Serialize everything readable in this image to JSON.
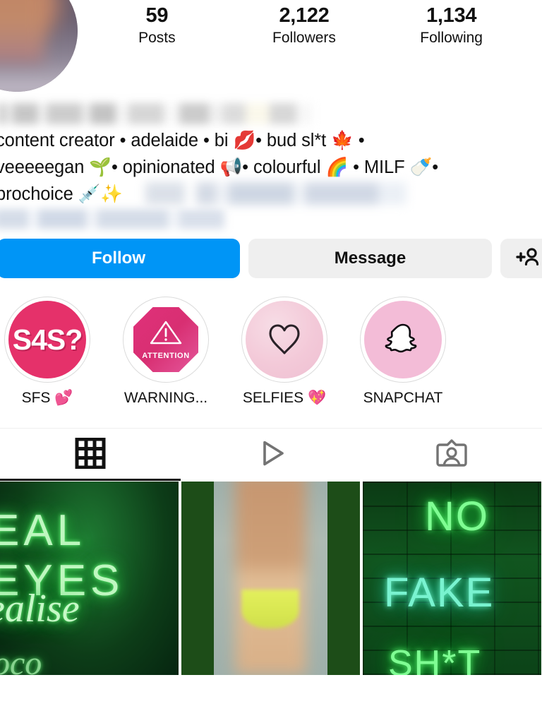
{
  "app": "instagram-profile",
  "profile": {
    "avatar_alt": "blurred-profile-photo",
    "name_redacted": true,
    "stats": [
      {
        "value": "59",
        "label": "Posts"
      },
      {
        "value": "2,122",
        "label": "Followers"
      },
      {
        "value": "1,134",
        "label": "Following"
      }
    ],
    "bio_lines": [
      "content creator • adelaide • bi 💋• bud sl*t 🍁 •",
      "veeeeegan 🌱• opinionated 📢• colourful 🌈 • MILF 🍼•",
      "prochoice 💉✨"
    ],
    "bio_redacted_tail": "",
    "bio_redacted_link": ""
  },
  "actions": {
    "follow_label": "Follow",
    "message_label": "Message",
    "suggested_icon": "add-person-icon"
  },
  "highlights": [
    {
      "label": "SFS 💕",
      "cover_text": "S4S?",
      "cover_type": "text-circle",
      "color": "#e5316a"
    },
    {
      "label": "WARNING...",
      "cover_text": "ATTENTION",
      "cover_type": "octagon-warning",
      "color": "#e0307a"
    },
    {
      "label": "SELFIES 💖",
      "cover_text": "",
      "cover_type": "heart-outline",
      "color": "#f3c9d8"
    },
    {
      "label": "SNAPCHAT",
      "cover_text": "",
      "cover_type": "snapchat-ghost",
      "color": "#f3bcd7"
    }
  ],
  "tabs": [
    {
      "name": "grid",
      "icon": "grid-icon",
      "active": true
    },
    {
      "name": "reels",
      "icon": "play-triangle-icon",
      "active": false
    },
    {
      "name": "tagged",
      "icon": "tagged-person-icon",
      "active": false
    }
  ],
  "grid_posts": [
    {
      "type": "neon-sign",
      "line1": "EAL EYES",
      "line2": "ealise",
      "line3": "oco"
    },
    {
      "type": "blurred-photo",
      "line1": "",
      "line2": "",
      "line3": ""
    },
    {
      "type": "neon-sign",
      "line1": "NO",
      "line2": "FAKE",
      "line3": "SH*T"
    }
  ],
  "colors": {
    "follow_blue": "#0095F6",
    "button_gray": "#EFEFEF",
    "text_dark": "#111111",
    "ring_gray": "#DBDBDB"
  }
}
